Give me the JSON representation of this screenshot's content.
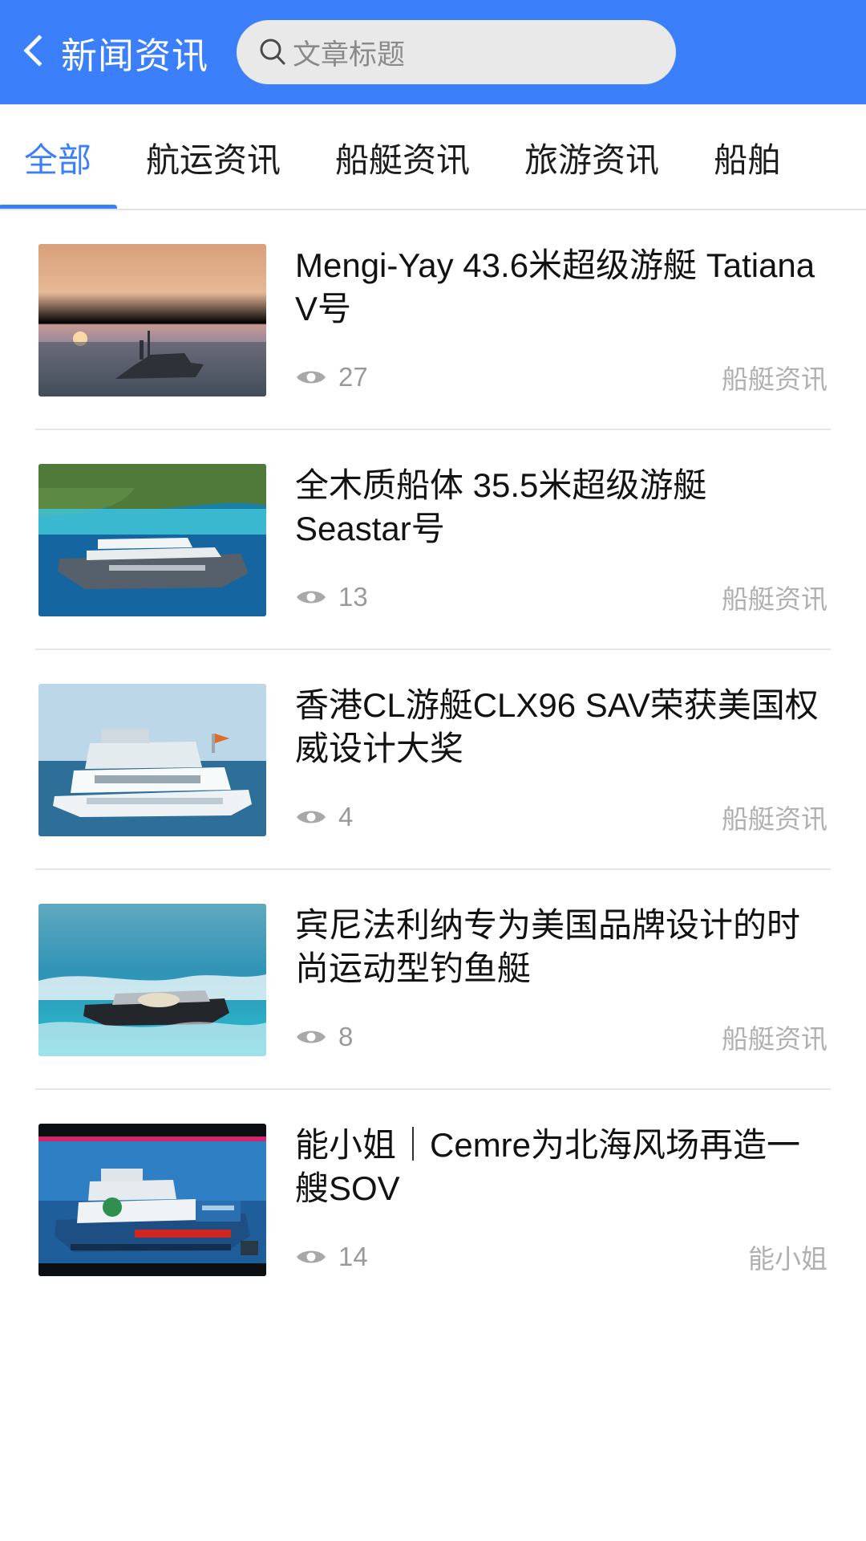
{
  "header": {
    "back_icon": "chevron-left-icon",
    "title": "新闻资讯",
    "search": {
      "icon": "search-icon",
      "placeholder": "文章标题",
      "value": ""
    },
    "background_color": "#3c7ffa"
  },
  "tabs": {
    "active_index": 0,
    "accent_color": "#3c7ffa",
    "items": [
      {
        "label": "全部"
      },
      {
        "label": "航运资讯"
      },
      {
        "label": "船艇资讯"
      },
      {
        "label": "旅游资讯"
      },
      {
        "label": "船舶"
      }
    ]
  },
  "articles": [
    {
      "title": "Mengi-Yay 43.6米超级游艇 Tatiana V号",
      "views": "27",
      "views_icon": "eye-icon",
      "category": "船艇资讯",
      "thumb": "yacht-at-sunset"
    },
    {
      "title": "全木质船体 35.5米超级游艇 Seastar号",
      "views": "13",
      "views_icon": "eye-icon",
      "category": "船艇资讯",
      "thumb": "yacht-near-green-island"
    },
    {
      "title": "香港CL游艇CLX96 SAV荣获美国权威设计大奖",
      "views": "4",
      "views_icon": "eye-icon",
      "category": "船艇资讯",
      "thumb": "white-motor-yacht"
    },
    {
      "title": "宾尼法利纳专为美国品牌设计的时尚运动型钓鱼艇",
      "views": "8",
      "views_icon": "eye-icon",
      "category": "船艇资讯",
      "thumb": "speedboat-turquoise-water"
    },
    {
      "title": "能小姐｜Cemre为北海风场再造一艘SOV",
      "views": "14",
      "views_icon": "eye-icon",
      "category": "能小姐",
      "thumb": "offshore-support-vessel"
    }
  ]
}
